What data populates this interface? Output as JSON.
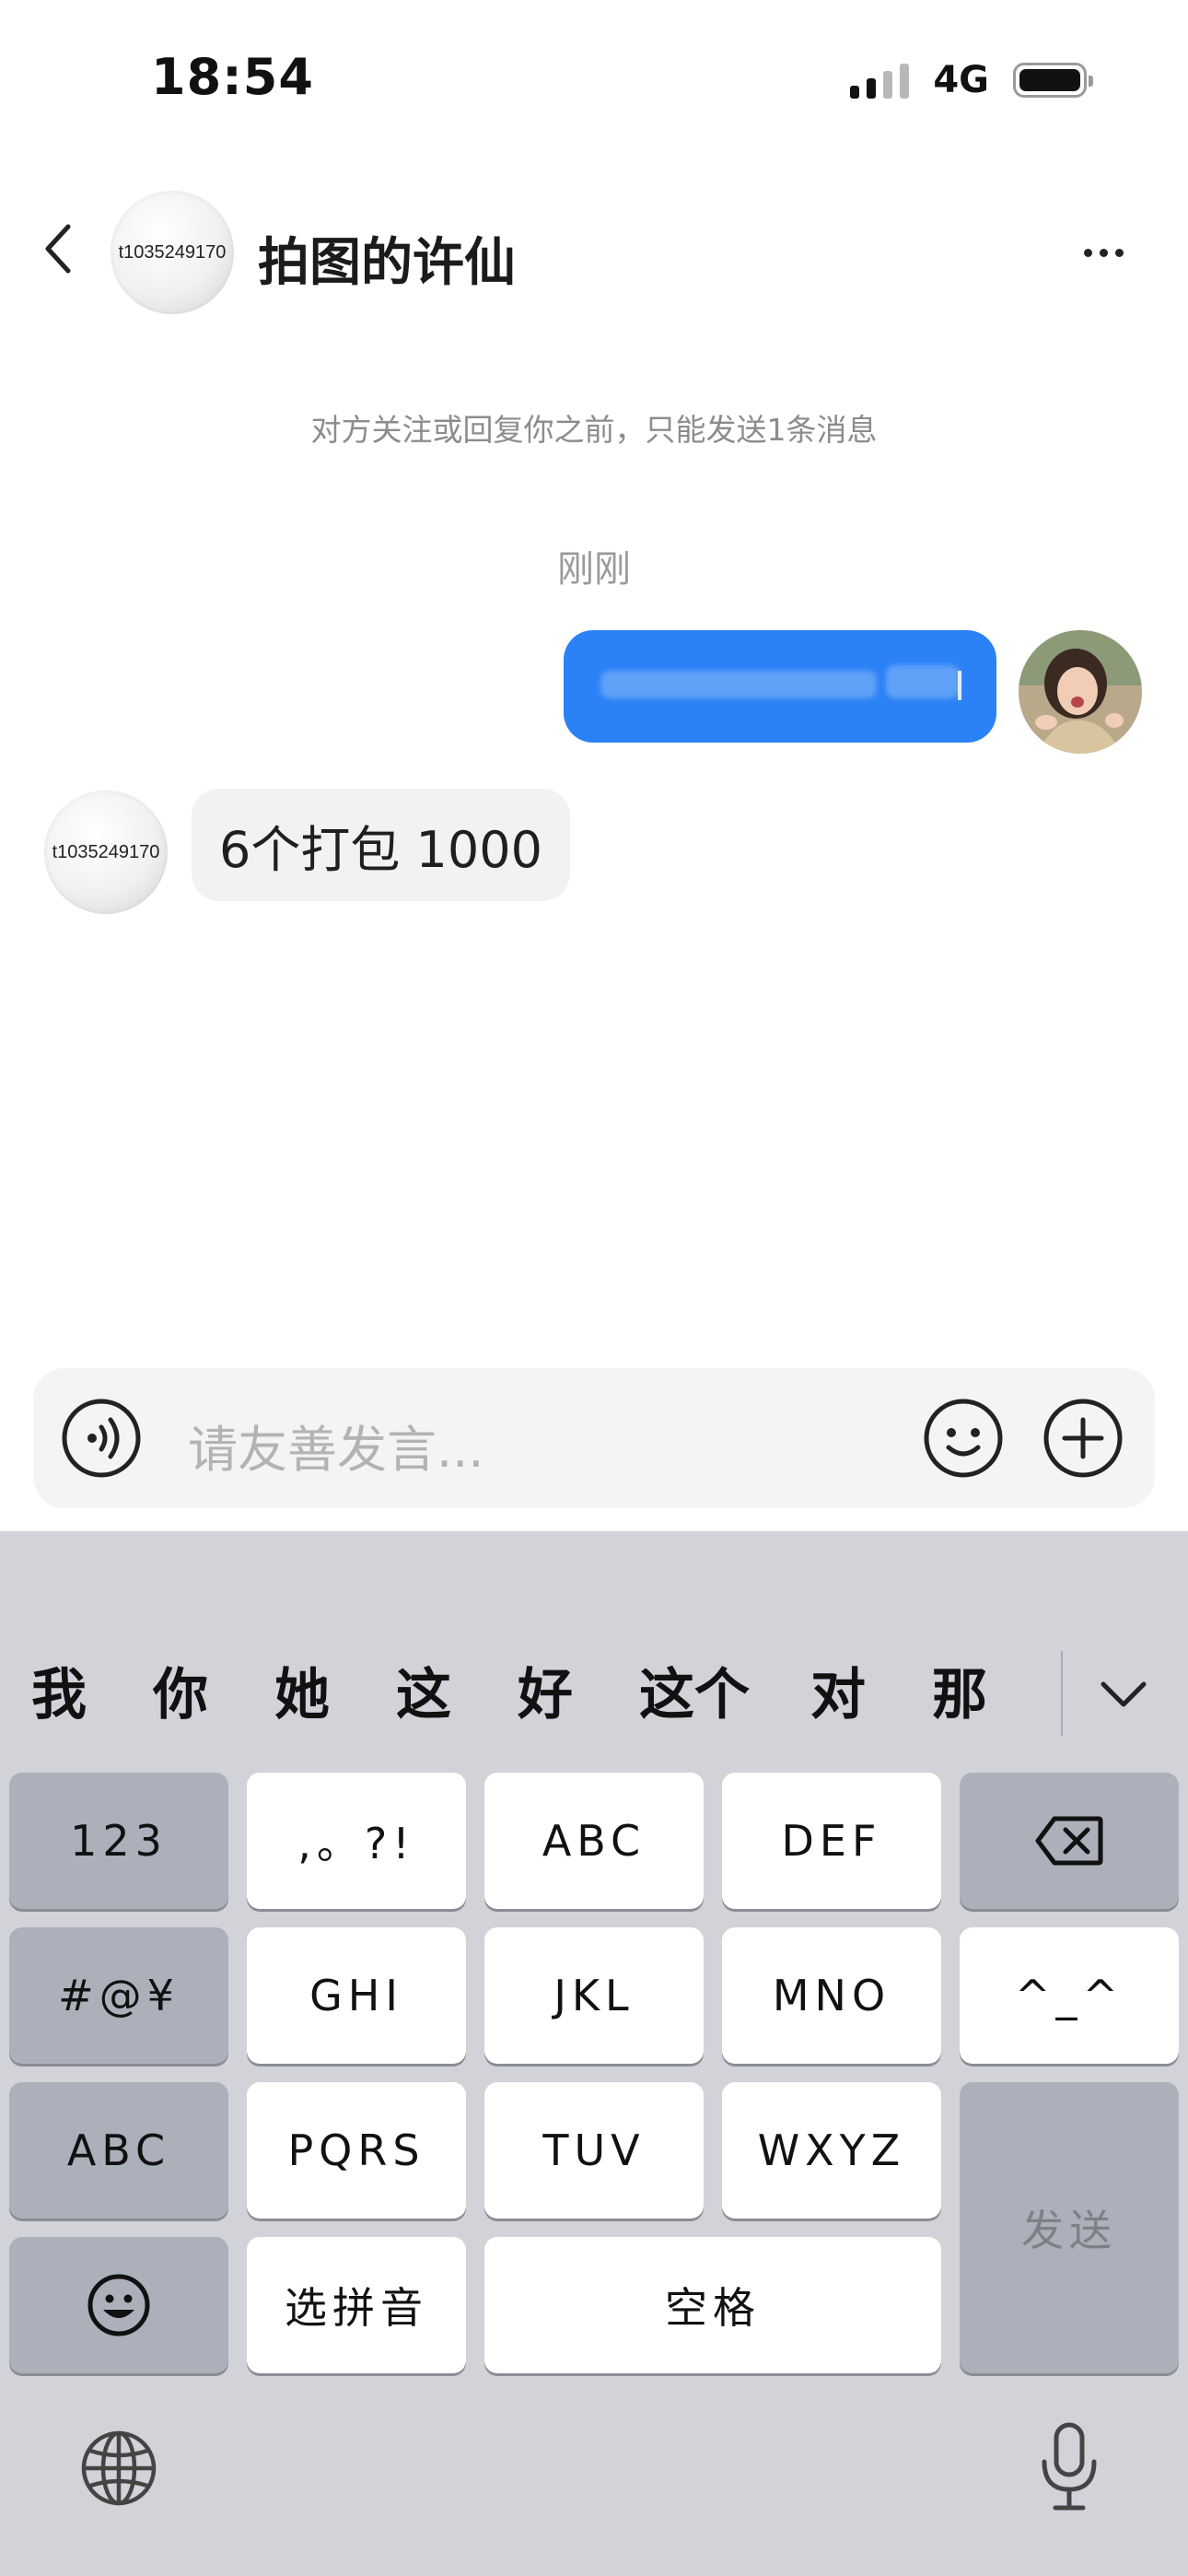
{
  "status_bar": {
    "time": "18:54",
    "network": "4G"
  },
  "header": {
    "avatar_text": "t1035249170",
    "title": "拍图的许仙"
  },
  "chat": {
    "notice": "对方关注或回复你之前，只能发送1条消息",
    "time_label": "刚刚",
    "incoming": {
      "avatar_text": "t1035249170",
      "text": "6个打包 1000"
    }
  },
  "input": {
    "placeholder": "请友善发言..."
  },
  "keyboard": {
    "candidates": [
      "我",
      "你",
      "她",
      "这",
      "好",
      "这个",
      "对",
      "那"
    ],
    "row1": [
      "123",
      ",。?!",
      "ABC",
      "DEF"
    ],
    "row2": [
      "#@¥",
      "GHI",
      "JKL",
      "MNO",
      "^_^"
    ],
    "row3": [
      "ABC",
      "PQRS",
      "TUV",
      "WXYZ"
    ],
    "row4": [
      "选拼音",
      "空格"
    ],
    "send": "发送"
  },
  "colors": {
    "accent_blue": "#2b82f6",
    "keyboard_bg": "#d1d3d9"
  },
  "icons": [
    "back-arrow-icon",
    "more-icon",
    "voice-icon",
    "emoji-icon",
    "plus-icon",
    "backspace-icon",
    "emoji-key-icon",
    "globe-icon",
    "mic-icon",
    "chevron-down-icon"
  ]
}
